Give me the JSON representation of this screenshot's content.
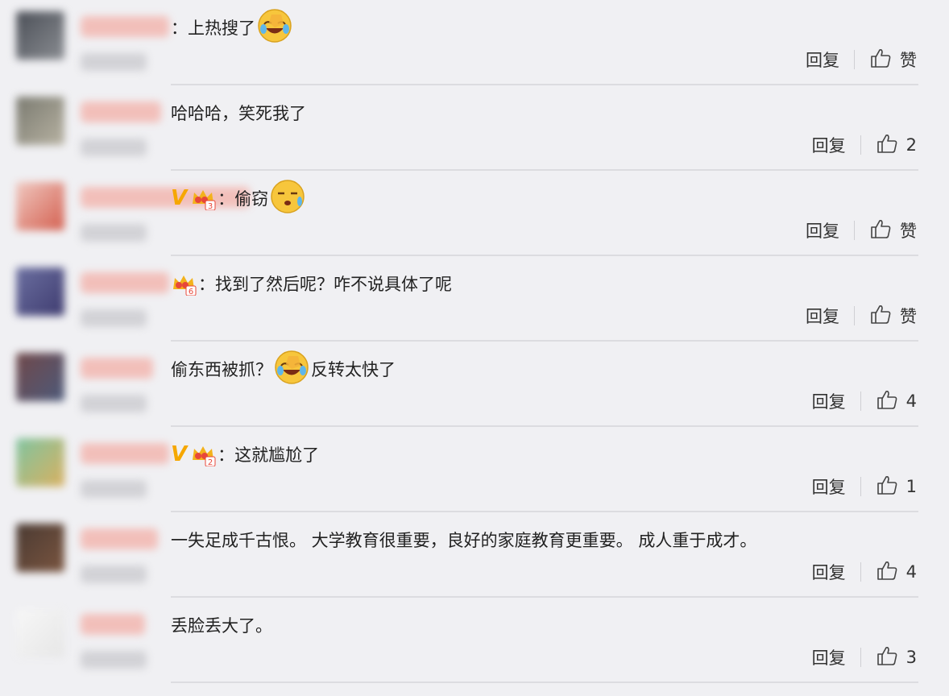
{
  "comments": [
    {
      "text_before": "：上热搜了",
      "text_after": "",
      "emoji": "laugh-cry",
      "badges": [],
      "reply_label": "回复",
      "like_label": "赞"
    },
    {
      "text_before": "哈哈哈，笑死我了",
      "text_after": "",
      "emoji": "",
      "badges": [],
      "reply_label": "回复",
      "like_label": "2"
    },
    {
      "text_before": "：偷窃",
      "text_after": "",
      "emoji": "sweat",
      "badges": [
        "v-badge",
        "crown-badge-3"
      ],
      "reply_label": "回复",
      "like_label": "赞"
    },
    {
      "text_before": "：找到了然后呢？咋不说具体了呢",
      "text_after": "",
      "emoji": "",
      "badges": [
        "crown-badge-6"
      ],
      "reply_label": "回复",
      "like_label": "赞"
    },
    {
      "text_before": "偷东西被抓？",
      "text_after": "反转太快了",
      "emoji": "laugh-cry",
      "badges": [],
      "reply_label": "回复",
      "like_label": "4"
    },
    {
      "text_before": "：这就尴尬了",
      "text_after": "",
      "emoji": "",
      "badges": [
        "v-badge",
        "crown-badge-2"
      ],
      "reply_label": "回复",
      "like_label": "1"
    },
    {
      "text_before": "一失足成千古恨。 大学教育很重要，良好的家庭教育更重要。 成人重于成才。",
      "text_after": "",
      "emoji": "",
      "badges": [],
      "reply_label": "回复",
      "like_label": "4"
    },
    {
      "text_before": "丢脸丢大了。",
      "text_after": "",
      "emoji": "",
      "badges": [],
      "reply_label": "回复",
      "like_label": "3"
    }
  ],
  "v_badge_text": "V",
  "crown_levels": {
    "crown-badge-3": "3",
    "crown-badge-6": "6",
    "crown-badge-2": "2"
  },
  "colors": {
    "background": "#f0f0f3",
    "divider": "#dcdce0",
    "v_badge": "#f6a700",
    "crown": "#f3b21c",
    "emoji": "#f7c63c"
  }
}
